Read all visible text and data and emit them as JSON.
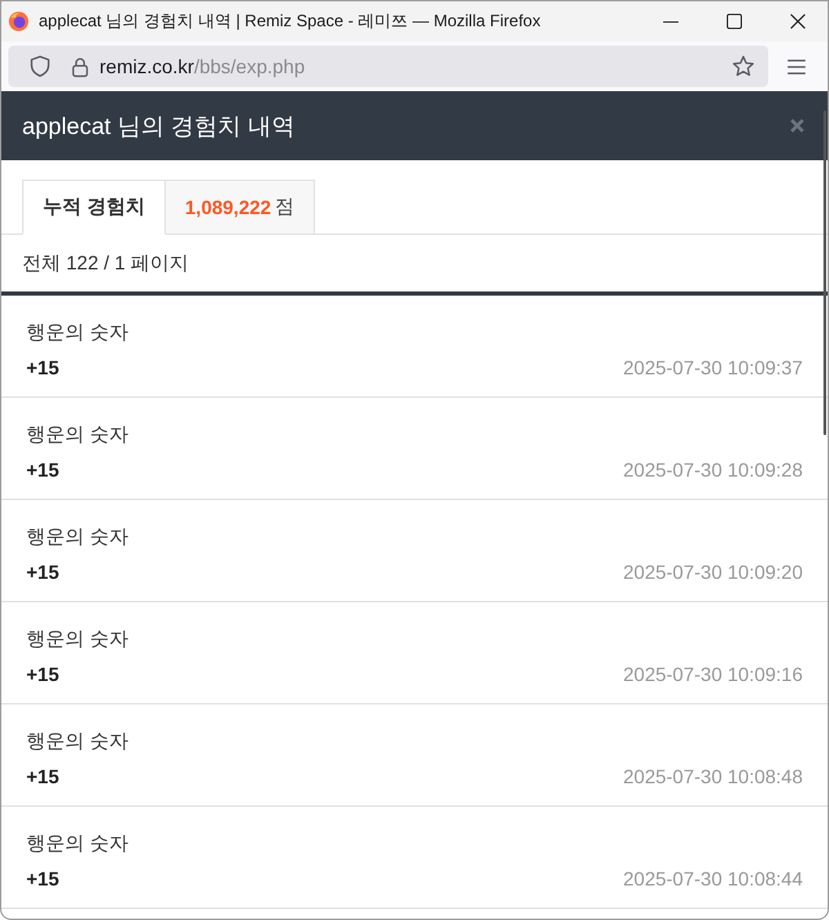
{
  "window": {
    "title": "applecat 님의 경험치 내역 | Remiz Space - 레미쯔 — Mozilla Firefox"
  },
  "address_bar": {
    "domain": "remiz.co.kr",
    "path": "/bbs/exp.php"
  },
  "dialog": {
    "title": "applecat 님의 경험치 내역"
  },
  "tabs": [
    {
      "kind": "label",
      "label": "누적 경험치",
      "selected": true
    },
    {
      "kind": "total",
      "value": "1,089,222",
      "unit": "점",
      "selected": false
    }
  ],
  "summary": "전체 122 / 1 페이지",
  "entries": [
    {
      "title": "행운의 숫자",
      "points": "+15",
      "datetime": "2025-07-30 10:09:37"
    },
    {
      "title": "행운의 숫자",
      "points": "+15",
      "datetime": "2025-07-30 10:09:28"
    },
    {
      "title": "행운의 숫자",
      "points": "+15",
      "datetime": "2025-07-30 10:09:20"
    },
    {
      "title": "행운의 숫자",
      "points": "+15",
      "datetime": "2025-07-30 10:09:16"
    },
    {
      "title": "행운의 숫자",
      "points": "+15",
      "datetime": "2025-07-30 10:08:48"
    },
    {
      "title": "행운의 숫자",
      "points": "+15",
      "datetime": "2025-07-30 10:08:44"
    }
  ]
}
